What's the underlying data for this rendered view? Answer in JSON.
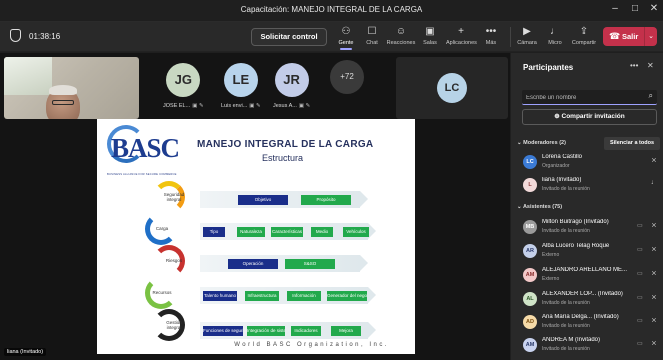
{
  "window": {
    "title": "Capacitación: MANEJO INTEGRAL DE LA CARGA",
    "minimize": "–",
    "maximize": "□",
    "close": "✕"
  },
  "toolbar": {
    "timer": "01:38:16",
    "request_control": "Solicitar control",
    "items": [
      {
        "label": "Gente",
        "icon": "people-icon",
        "glyph": "⚇",
        "active": true
      },
      {
        "label": "Chat",
        "icon": "chat-icon",
        "glyph": "☐",
        "active": false
      },
      {
        "label": "Reacciones",
        "icon": "reactions-icon",
        "glyph": "☺",
        "active": false
      },
      {
        "label": "Salas",
        "icon": "rooms-icon",
        "glyph": "▣",
        "active": false
      },
      {
        "label": "Aplicaciones",
        "icon": "apps-icon",
        "glyph": "+",
        "active": false
      },
      {
        "label": "Más",
        "icon": "more-icon",
        "glyph": "•••",
        "active": false
      }
    ],
    "av_items": [
      {
        "label": "Cámara",
        "icon": "camera-off-icon",
        "glyph": "▶"
      },
      {
        "label": "Micro",
        "icon": "mic-off-icon",
        "glyph": "♩"
      },
      {
        "label": "Compartir",
        "icon": "share-icon",
        "glyph": "⇪"
      }
    ],
    "leave": "Salir",
    "leave_icon": "☎",
    "leave_dropdown": "⌄"
  },
  "stage": {
    "tiles": [
      {
        "initials": "JG",
        "name": "JOSE EL...",
        "indicators": "▣ ✎"
      },
      {
        "initials": "LE",
        "name": "Luis envi...",
        "indicators": "▣ ✎"
      },
      {
        "initials": "JR",
        "name": "Jesus A...",
        "indicators": "▣ ✎"
      },
      {
        "initials": "+72",
        "name": "",
        "indicators": ""
      }
    ],
    "side_tile": {
      "initials": "LC"
    },
    "presenter_tag": "liana (Invitado)"
  },
  "slide": {
    "logo": "BASC",
    "logo_sub": "BUSINESS ALLIANCE FOR SECURE COMMERCE",
    "title": "MANEJO INTEGRAL DE LA CARGA",
    "subtitle": "Estructura",
    "steps": [
      "Seguridad integral",
      "Carga",
      "Riesgos",
      "Recursos",
      "Gestión integral"
    ],
    "row1": [
      "Objetivo",
      "Propósito"
    ],
    "row2": [
      "Tipo",
      "Naturaleza",
      "Características",
      "Medio",
      "Vehículos"
    ],
    "row3": [
      "Operación",
      "S&SO"
    ],
    "row4": [
      "Talento humano",
      "Infraestructura",
      "Información",
      "Generador del negocio"
    ],
    "row5": [
      "Funciones de seguridad integral (SGCS)",
      "Integración de sistemas",
      "Indicadores",
      "Mejora"
    ],
    "footer": "World BASC Organization, Inc."
  },
  "participants": {
    "title": "Participantes",
    "more": "•••",
    "close": "✕",
    "search_placeholder": "Escribe un nombre",
    "share_invite": "Compartir invitación",
    "moderators_header": "Moderadores (2)",
    "silence_all": "Silenciar a todos",
    "attendees_header": "Asistentes (75)",
    "moderators": [
      {
        "initials": "LC",
        "name": "Lorena Castillo",
        "role": "Organizador",
        "color": "#3b7bd6",
        "text_color": "#fff"
      },
      {
        "initials": "L",
        "name": "liana (Invitado)",
        "role": "Invitado de la reunión",
        "color": "#f2dada",
        "text_color": "#8a3a3a"
      }
    ],
    "attendees": [
      {
        "initials": "MB",
        "name": "Milton Buitrago (Invitado)",
        "role": "Invitado de la reunión",
        "color": "#9a9a9a",
        "text_color": "#fff"
      },
      {
        "initials": "AR",
        "name": "Alba Lucero Telag Roque",
        "role": "Externo",
        "color": "#c4d0ea",
        "text_color": "#2b3a6a"
      },
      {
        "initials": "AM",
        "name": "ALEJANDRO ARELLANO ME...",
        "role": "Externo",
        "color": "#f3c9c9",
        "text_color": "#8a2e2e"
      },
      {
        "initials": "AL",
        "name": "ALEXANDER LOP... (Invitado)",
        "role": "Invitado de la reunión",
        "color": "#cfe3c7",
        "text_color": "#2f5a2a"
      },
      {
        "initials": "AD",
        "name": "Ana María Delga... (Invitado)",
        "role": "Invitado de la reunión",
        "color": "#f6dba8",
        "text_color": "#7a4e10"
      },
      {
        "initials": "AM",
        "name": "ANDREA M (Invitado)",
        "role": "Invitado de la reunión",
        "color": "#c9d3ef",
        "text_color": "#2b3a6a"
      }
    ]
  }
}
